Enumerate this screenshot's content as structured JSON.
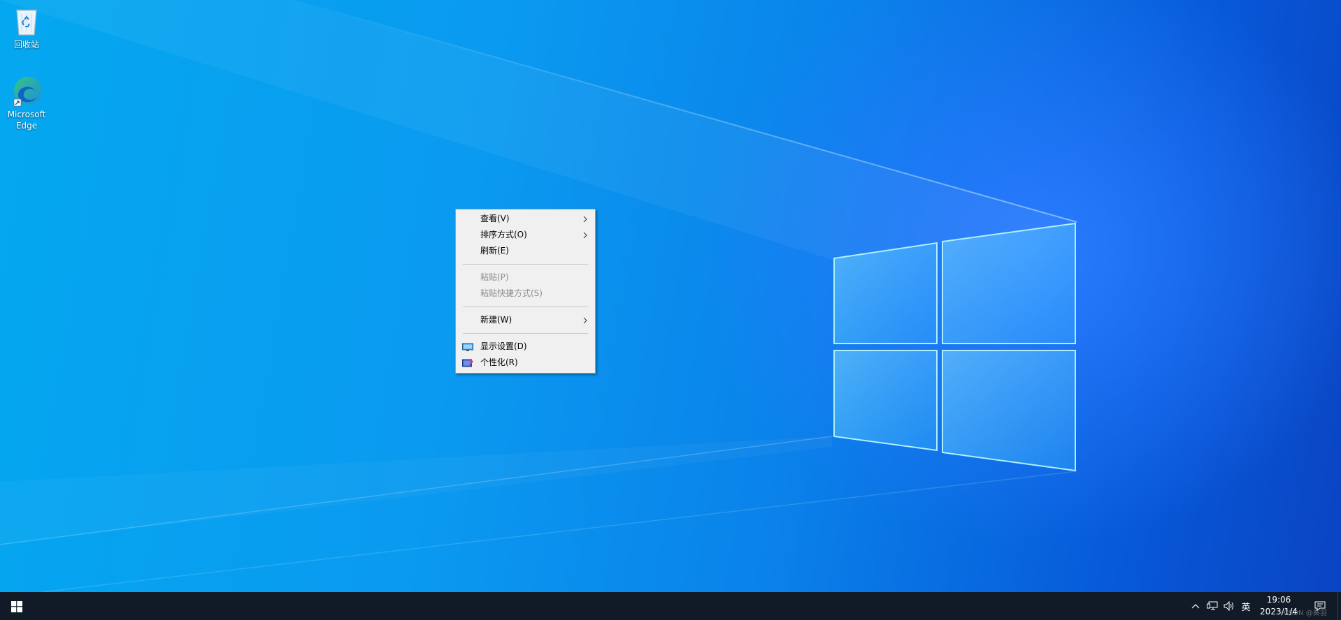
{
  "desktop": {
    "icons": [
      {
        "label": "回收站",
        "icon": "recycle-bin-icon"
      },
      {
        "label": "Microsoft Edge",
        "icon": "edge-icon"
      }
    ]
  },
  "context_menu": {
    "items": [
      {
        "label": "查看(V)",
        "submenu": true,
        "disabled": false
      },
      {
        "label": "排序方式(O)",
        "submenu": true,
        "disabled": false
      },
      {
        "label": "刷新(E)",
        "submenu": false,
        "disabled": false
      },
      {
        "label": "粘贴(P)",
        "submenu": false,
        "disabled": true
      },
      {
        "label": "粘贴快捷方式(S)",
        "submenu": false,
        "disabled": true
      },
      {
        "label": "新建(W)",
        "submenu": true,
        "disabled": false
      },
      {
        "label": "显示设置(D)",
        "submenu": false,
        "disabled": false,
        "icon": "display-settings-icon"
      },
      {
        "label": "个性化(R)",
        "submenu": false,
        "disabled": false,
        "icon": "personalize-icon"
      }
    ]
  },
  "taskbar": {
    "language": "英",
    "time": "19:06",
    "date": "2023/1/4",
    "watermark": "CSDN @奏羽"
  },
  "colors": {
    "taskbar_bg": "#101b27",
    "menu_bg": "#f0f0f0",
    "accent": "#0a82ea"
  }
}
